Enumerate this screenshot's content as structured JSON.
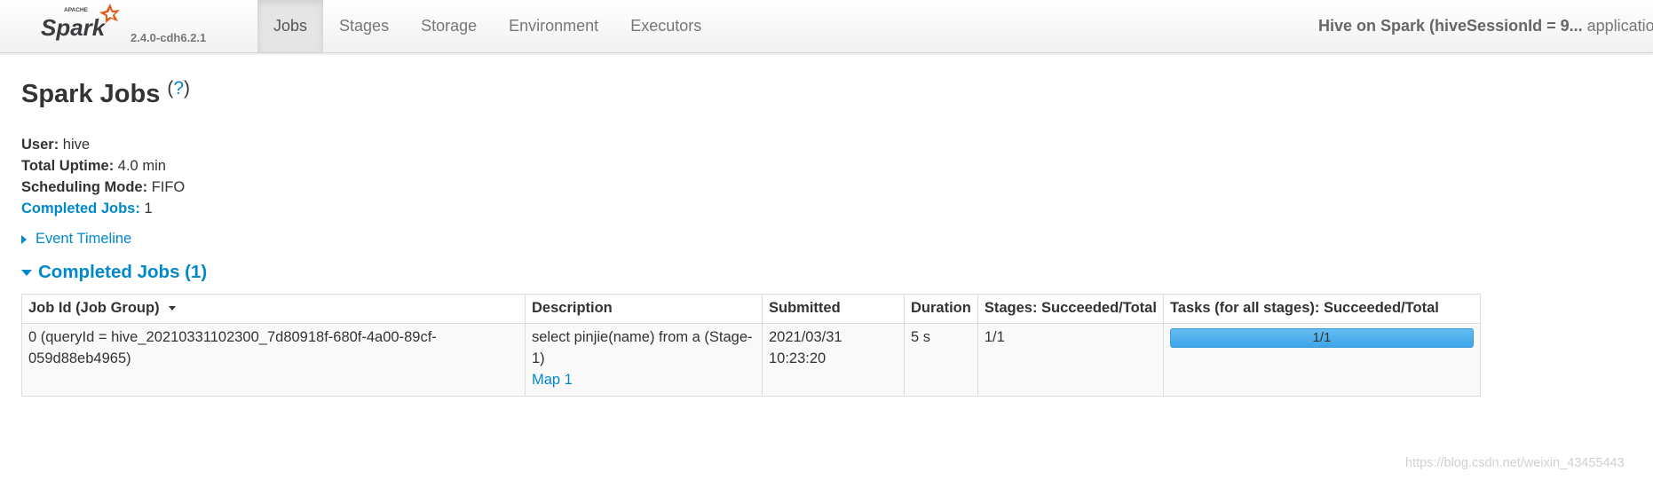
{
  "navbar": {
    "brand_top": "APACHE",
    "brand_name": "Spark",
    "version": "2.4.0-cdh6.2.1",
    "tabs": [
      {
        "label": "Jobs",
        "active": true
      },
      {
        "label": "Stages",
        "active": false
      },
      {
        "label": "Storage",
        "active": false
      },
      {
        "label": "Environment",
        "active": false
      },
      {
        "label": "Executors",
        "active": false
      }
    ],
    "app_title_bold": "Hive on Spark (hiveSessionId = 9...",
    "app_title_rest": " applicatio"
  },
  "page": {
    "title": "Spark Jobs",
    "help_open": "(",
    "help_mark": "?",
    "help_close": ")"
  },
  "summary": {
    "user_label": "User:",
    "user_value": "hive",
    "uptime_label": "Total Uptime:",
    "uptime_value": "4.0 min",
    "mode_label": "Scheduling Mode:",
    "mode_value": "FIFO",
    "completed_label": "Completed Jobs:",
    "completed_value": "1"
  },
  "event_timeline": "Event Timeline",
  "completed_section": "Completed Jobs (1)",
  "table": {
    "headers": {
      "job_id": "Job Id (Job Group)",
      "description": "Description",
      "submitted": "Submitted",
      "duration": "Duration",
      "stages": "Stages: Succeeded/Total",
      "tasks": "Tasks (for all stages): Succeeded/Total"
    },
    "rows": [
      {
        "job_id": "0 (queryId = hive_20210331102300_7d80918f-680f-4a00-89cf-059d88eb4965)",
        "description": "select pinjie(name) from a (Stage-1)",
        "description_link": "Map 1",
        "submitted": "2021/03/31 10:23:20",
        "duration": "5 s",
        "stages": "1/1",
        "tasks_text": "1/1",
        "tasks_fraction": 1.0
      }
    ]
  },
  "watermark": "https://blog.csdn.net/weixin_43455443",
  "colors": {
    "link": "#0088cc",
    "progress": "#3da5e8",
    "spark_orange": "#e25a1c"
  }
}
